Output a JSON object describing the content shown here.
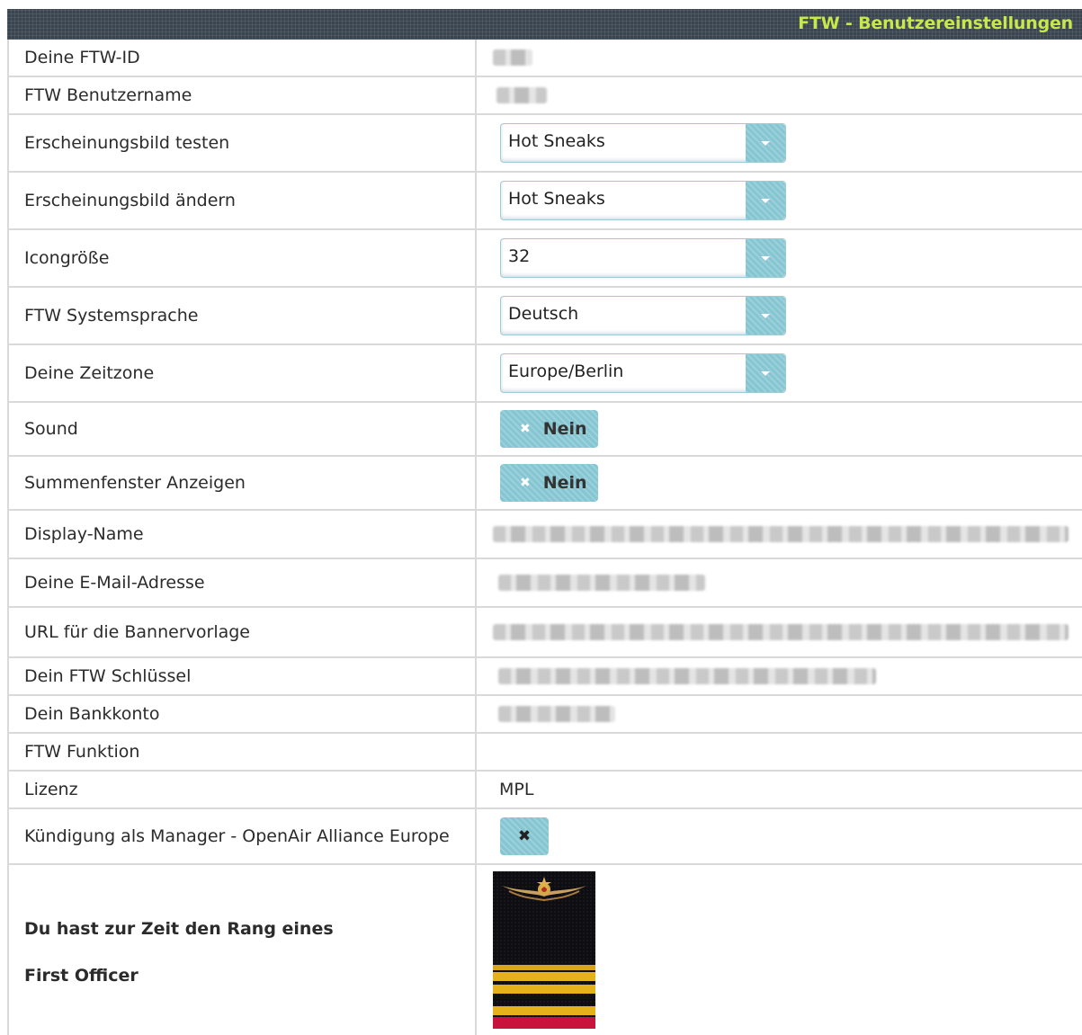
{
  "header": {
    "title": "FTW - Benutzereinstellungen"
  },
  "rows": {
    "ftw_id": {
      "label": "Deine FTW-ID"
    },
    "username": {
      "label": "FTW Benutzername"
    },
    "theme_test": {
      "label": "Erscheinungsbild testen",
      "value": "Hot Sneaks"
    },
    "theme_change": {
      "label": "Erscheinungsbild ändern",
      "value": "Hot Sneaks"
    },
    "icon_size": {
      "label": "Icongröße",
      "value": "32"
    },
    "language": {
      "label": "FTW Systemsprache",
      "value": "Deutsch"
    },
    "timezone": {
      "label": "Deine Zeitzone",
      "value": "Europe/Berlin"
    },
    "sound": {
      "label": "Sound",
      "value": "Nein"
    },
    "summary_window": {
      "label": "Summenfenster Anzeigen",
      "value": "Nein"
    },
    "display_name": {
      "label": "Display-Name"
    },
    "email": {
      "label": "Deine E-Mail-Adresse"
    },
    "banner_url": {
      "label": "URL für die Bannervorlage"
    },
    "ftw_key": {
      "label": "Dein FTW Schlüssel"
    },
    "bank": {
      "label": "Dein Bankkonto"
    },
    "function": {
      "label": "FTW Funktion"
    },
    "license": {
      "label": "Lizenz",
      "value": "MPL"
    },
    "resign": {
      "label": "Kündigung als Manager - OpenAir Alliance Europe",
      "button": "✖"
    },
    "rank": {
      "line1": "Du hast zur Zeit den Rang eines",
      "line2": "First Officer"
    }
  },
  "colors": {
    "accent": "#86c6d2",
    "header_bg": "#3a4550",
    "header_text": "#c8e84a"
  },
  "icons": {
    "dropdown": "chevron-down-icon",
    "toggle_off": "close-icon",
    "rank": "epaulette-icon"
  }
}
